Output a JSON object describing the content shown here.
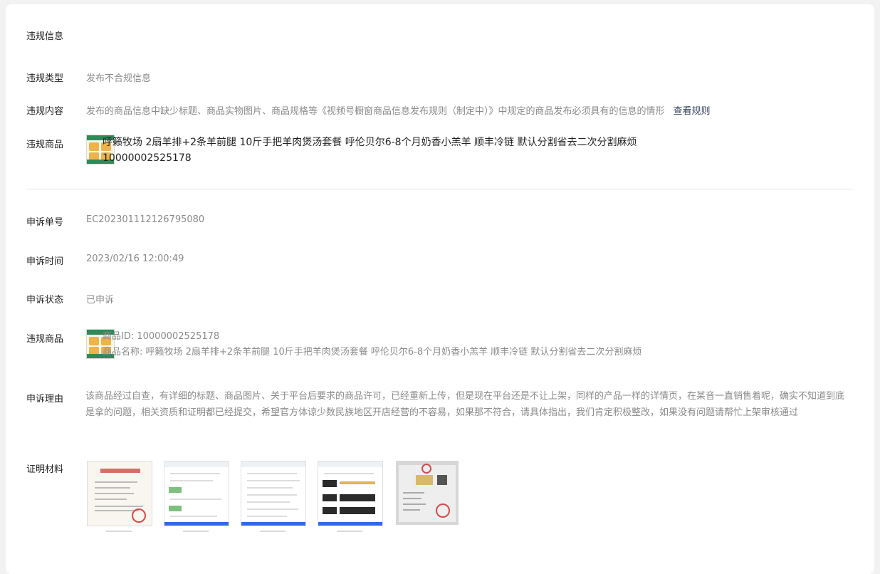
{
  "section_title": "违规信息",
  "violation": {
    "type_label": "违规类型",
    "type_value": "发布不合规信息",
    "content_label": "违规内容",
    "content_value": "发布的商品信息中缺少标题、商品实物图片、商品规格等《视频号橱窗商品信息发布规则（制定中）》中规定的商品发布必须具有的信息的情形",
    "rule_link": "查看规则",
    "product_label": "违规商品",
    "product_name": "呼籁牧场 2扇羊排+2条羊前腿 10斤手把羊肉煲汤套餐 呼伦贝尔6-8个月奶香小羔羊 顺丰冷链 默认分割省去二次分割麻烦",
    "product_id": "10000002525178"
  },
  "appeal": {
    "no_label": "申诉单号",
    "no_value": "EC202301112126795080",
    "time_label": "申诉时间",
    "time_value": "2023/02/16 12:00:49",
    "status_label": "申诉状态",
    "status_value": "已申诉",
    "product_label": "违规商品",
    "product_id_line": "商品ID: 10000002525178",
    "product_name_line": "商品名称: 呼籁牧场 2扇羊排+2条羊前腿 10斤手把羊肉煲汤套餐 呼伦贝尔6-8个月奶香小羔羊 顺丰冷链 默认分割省去二次分割麻烦",
    "reason_label": "申诉理由",
    "reason_value": "该商品经过自查，有详细的标题、商品图片、关于平台后要求的商品许可，已经重新上传，但是现在平台还是不让上架，同样的产品一样的详情页，在某音一直销售着呢，确实不知道到底是拿的问题，相关资质和证明都已经提交，希望官方体谅少数民族地区开店经营的不容易，如果那不符合，请具体指出，我们肯定积极整改，如果没有问题请帮忙上架审核通过",
    "materials_label": "证明材料"
  }
}
